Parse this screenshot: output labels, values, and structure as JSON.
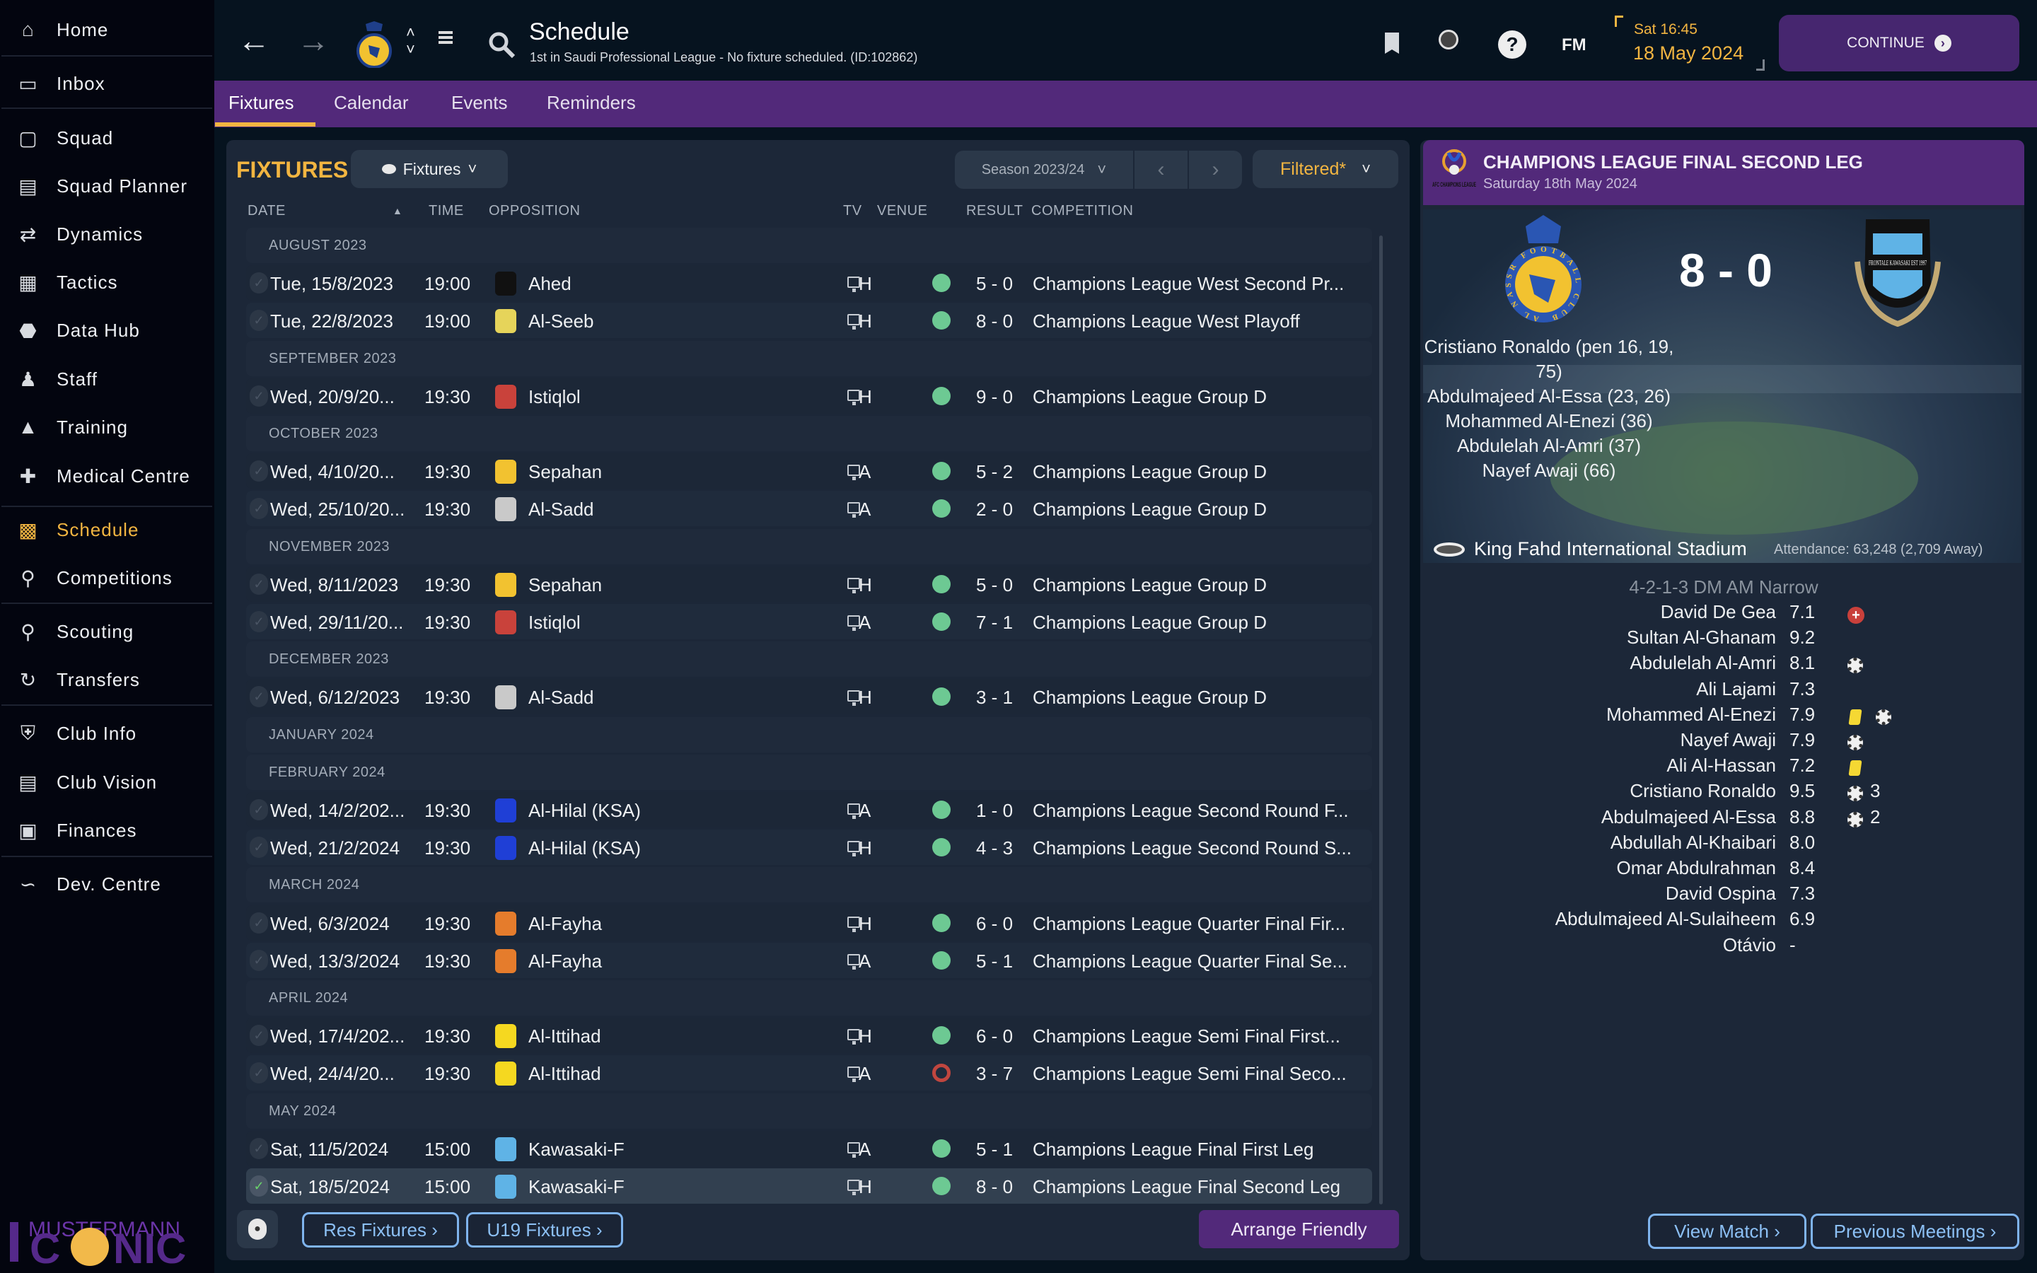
{
  "sidebar": {
    "items": [
      {
        "label": "Home",
        "icon": "home-icon"
      },
      {
        "label": "Inbox",
        "icon": "inbox-icon"
      },
      {
        "label": "Squad",
        "icon": "shirt-icon"
      },
      {
        "label": "Squad Planner",
        "icon": "clipboard-icon"
      },
      {
        "label": "Dynamics",
        "icon": "dynamics-icon"
      },
      {
        "label": "Tactics",
        "icon": "tactics-board-icon"
      },
      {
        "label": "Data Hub",
        "icon": "data-hub-icon"
      },
      {
        "label": "Staff",
        "icon": "staff-icon"
      },
      {
        "label": "Training",
        "icon": "training-cone-icon"
      },
      {
        "label": "Medical Centre",
        "icon": "medical-kit-icon"
      },
      {
        "label": "Schedule",
        "icon": "calendar-icon",
        "active": true
      },
      {
        "label": "Competitions",
        "icon": "trophy-icon"
      },
      {
        "label": "Scouting",
        "icon": "magnifier-icon"
      },
      {
        "label": "Transfers",
        "icon": "transfer-arrows-icon"
      },
      {
        "label": "Club Info",
        "icon": "shield-icon"
      },
      {
        "label": "Club Vision",
        "icon": "briefcase-icon"
      },
      {
        "label": "Finances",
        "icon": "banknote-icon"
      },
      {
        "label": "Dev. Centre",
        "icon": "growth-line-icon"
      }
    ],
    "logo_text": "MUSTERMANN ICONIC"
  },
  "header": {
    "title": "Schedule",
    "subtitle": "1st in Saudi Professional League - No fixture scheduled. (ID:102862)",
    "time": "Sat 16:45",
    "date": "18 May 2024",
    "continue_label": "CONTINUE",
    "fm_label": "FM"
  },
  "tabs": [
    {
      "label": "Fixtures",
      "active": true
    },
    {
      "label": "Calendar"
    },
    {
      "label": "Events"
    },
    {
      "label": "Reminders"
    }
  ],
  "fixtures": {
    "title": "FIXTURES",
    "view_dropdown": "Fixtures",
    "season": "Season 2023/24",
    "filter": "Filtered*",
    "columns": {
      "date": "DATE",
      "time": "TIME",
      "opposition": "OPPOSITION",
      "tv": "TV",
      "venue": "VENUE",
      "result": "RESULT",
      "competition": "COMPETITION"
    },
    "rows": [
      {
        "month": "AUGUST 2023"
      },
      {
        "date": "Tue, 15/8/2023",
        "time": "19:00",
        "opp": "Ahed",
        "badge": "#111111",
        "venue": "H",
        "score": "5 - 0",
        "outcome": "win",
        "comp": "Champions League West Second Pr..."
      },
      {
        "date": "Tue, 22/8/2023",
        "time": "19:00",
        "opp": "Al-Seeb",
        "badge": "#e6d45a",
        "venue": "H",
        "score": "8 - 0",
        "outcome": "win",
        "comp": "Champions League West Playoff"
      },
      {
        "month": "SEPTEMBER 2023"
      },
      {
        "date": "Wed, 20/9/20...",
        "time": "19:30",
        "opp": "Istiqlol",
        "badge": "#c9423b",
        "venue": "H",
        "score": "9 - 0",
        "outcome": "win",
        "comp": "Champions League Group D"
      },
      {
        "month": "OCTOBER 2023"
      },
      {
        "date": "Wed, 4/10/20...",
        "time": "19:30",
        "opp": "Sepahan",
        "badge": "#f2c230",
        "venue": "A",
        "score": "5 - 2",
        "outcome": "win",
        "comp": "Champions League Group D"
      },
      {
        "date": "Wed, 25/10/20...",
        "time": "19:30",
        "opp": "Al-Sadd",
        "badge": "#c9c9c9",
        "venue": "A",
        "score": "2 - 0",
        "outcome": "win",
        "comp": "Champions League Group D"
      },
      {
        "month": "NOVEMBER 2023"
      },
      {
        "date": "Wed, 8/11/2023",
        "time": "19:30",
        "opp": "Sepahan",
        "badge": "#f2c230",
        "venue": "H",
        "score": "5 - 0",
        "outcome": "win",
        "comp": "Champions League Group D"
      },
      {
        "date": "Wed, 29/11/20...",
        "time": "19:30",
        "opp": "Istiqlol",
        "badge": "#c9423b",
        "venue": "A",
        "score": "7 - 1",
        "outcome": "win",
        "comp": "Champions League Group D"
      },
      {
        "month": "DECEMBER 2023"
      },
      {
        "date": "Wed, 6/12/2023",
        "time": "19:30",
        "opp": "Al-Sadd",
        "badge": "#c9c9c9",
        "venue": "H",
        "score": "3 - 1",
        "outcome": "win",
        "comp": "Champions League Group D"
      },
      {
        "month": "JANUARY 2024"
      },
      {
        "month": "FEBRUARY 2024"
      },
      {
        "date": "Wed, 14/2/202...",
        "time": "19:30",
        "opp": "Al-Hilal (KSA)",
        "badge": "#1f3fd6",
        "venue": "A",
        "score": "1 - 0",
        "outcome": "win",
        "comp": "Champions League Second Round F..."
      },
      {
        "date": "Wed, 21/2/2024",
        "time": "19:30",
        "opp": "Al-Hilal (KSA)",
        "badge": "#1f3fd6",
        "venue": "H",
        "score": "4 - 3",
        "outcome": "win",
        "comp": "Champions League Second Round S..."
      },
      {
        "month": "MARCH 2024"
      },
      {
        "date": "Wed, 6/3/2024",
        "time": "19:30",
        "opp": "Al-Fayha",
        "badge": "#e57c2c",
        "venue": "H",
        "score": "6 - 0",
        "outcome": "win",
        "comp": "Champions League Quarter Final Fir..."
      },
      {
        "date": "Wed, 13/3/2024",
        "time": "19:30",
        "opp": "Al-Fayha",
        "badge": "#e57c2c",
        "venue": "A",
        "score": "5 - 1",
        "outcome": "win",
        "comp": "Champions League Quarter Final Se..."
      },
      {
        "month": "APRIL 2024"
      },
      {
        "date": "Wed, 17/4/202...",
        "time": "19:30",
        "opp": "Al-Ittihad",
        "badge": "#f5d820",
        "venue": "H",
        "score": "6 - 0",
        "outcome": "win",
        "comp": "Champions League Semi Final First..."
      },
      {
        "date": "Wed, 24/4/20...",
        "time": "19:30",
        "opp": "Al-Ittihad",
        "badge": "#f5d820",
        "venue": "A",
        "score": "3 - 7",
        "outcome": "loss",
        "comp": "Champions League Semi Final Seco..."
      },
      {
        "month": "MAY 2024"
      },
      {
        "date": "Sat, 11/5/2024",
        "time": "15:00",
        "opp": "Kawasaki-F",
        "badge": "#5fb3e6",
        "venue": "A",
        "score": "5 - 1",
        "outcome": "win",
        "comp": "Champions League Final First Leg"
      },
      {
        "date": "Sat, 18/5/2024",
        "time": "15:00",
        "opp": "Kawasaki-F",
        "badge": "#5fb3e6",
        "venue": "H",
        "score": "8 - 0",
        "outcome": "win",
        "comp": "Champions League Final Second Leg",
        "selected": true
      }
    ],
    "res_fixtures": "Res Fixtures ›",
    "u19_fixtures": "U19 Fixtures ›",
    "arrange_friendly": "Arrange Friendly"
  },
  "match": {
    "title": "CHAMPIONS LEAGUE FINAL SECOND LEG",
    "date": "Saturday 18th May 2024",
    "competition_logo_text": "AFC CHAMPIONS LEAGUE",
    "score": "8 - 0",
    "home_crest_text": "AL NASSR FOOTBALL CLUB",
    "away_crest_text": "FRONTALE KAWASAKI EST 1997",
    "scorers": [
      "Cristiano Ronaldo (pen 16, 19,",
      "75)",
      "Abdulmajeed Al-Essa (23, 26)",
      "Mohammed Al-Enezi (36)",
      "Abdulelah Al-Amri (37)",
      "Nayef Awaji (66)"
    ],
    "stadium": "King Fahd International Stadium",
    "attendance": "Attendance: 63,248 (2,709 Away)",
    "formation": "4-2-1-3 DM AM Narrow",
    "players": [
      {
        "name": "David De Gea",
        "rating": "7.1",
        "icons": [
          "injury"
        ]
      },
      {
        "name": "Sultan Al-Ghanam",
        "rating": "9.2",
        "icons": []
      },
      {
        "name": "Abdulelah Al-Amri",
        "rating": "8.1",
        "icons": [
          "goal"
        ]
      },
      {
        "name": "Ali Lajami",
        "rating": "7.3",
        "icons": []
      },
      {
        "name": "Mohammed Al-Enezi",
        "rating": "7.9",
        "icons": [
          "yellow",
          "goal"
        ]
      },
      {
        "name": "Nayef Awaji",
        "rating": "7.9",
        "icons": [
          "goal"
        ]
      },
      {
        "name": "Ali Al-Hassan",
        "rating": "7.2",
        "icons": [
          "yellow"
        ]
      },
      {
        "name": "Cristiano Ronaldo",
        "rating": "9.5",
        "icons": [
          "goal"
        ],
        "goals": "3"
      },
      {
        "name": "Abdulmajeed Al-Essa",
        "rating": "8.8",
        "icons": [
          "goal"
        ],
        "goals": "2"
      },
      {
        "name": "Abdullah Al-Khaibari",
        "rating": "8.0",
        "icons": []
      },
      {
        "name": "Omar Abdulrahman",
        "rating": "8.4",
        "icons": []
      },
      {
        "name": "David Ospina",
        "rating": "7.3",
        "icons": []
      },
      {
        "name": "Abdulmajeed Al-Sulaiheem",
        "rating": "6.9",
        "icons": []
      },
      {
        "name": "Otávio",
        "rating": "-",
        "icons": []
      }
    ],
    "view_match": "View Match ›",
    "previous_meetings": "Previous Meetings ›"
  },
  "colors": {
    "accent": "#f2b541",
    "purple": "#52297a",
    "win": "#6dc993",
    "loss": "#c0463f",
    "panel": "#1c2738"
  }
}
